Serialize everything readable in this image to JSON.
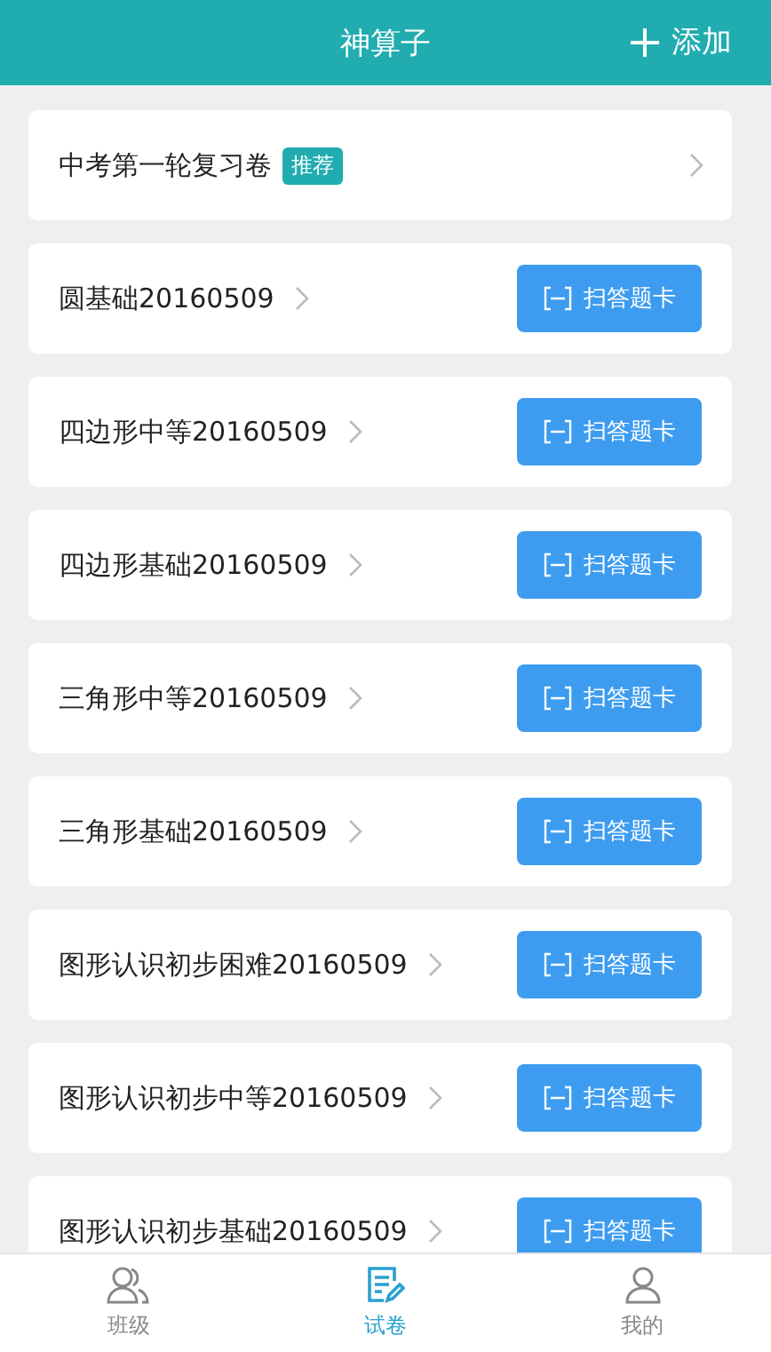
{
  "header": {
    "title": "神算子",
    "add_label": "添加"
  },
  "featured": {
    "title": "中考第一轮复习卷",
    "badge": "推荐"
  },
  "papers": [
    {
      "name": "圆基础20160509",
      "button": "扫答题卡"
    },
    {
      "name": "四边形中等20160509",
      "button": "扫答题卡"
    },
    {
      "name": "四边形基础20160509",
      "button": "扫答题卡"
    },
    {
      "name": "三角形中等20160509",
      "button": "扫答题卡"
    },
    {
      "name": "三角形基础20160509",
      "button": "扫答题卡"
    },
    {
      "name": "图形认识初步困难20160509",
      "button": "扫答题卡"
    },
    {
      "name": "图形认识初步中等20160509",
      "button": "扫答题卡"
    },
    {
      "name": "图形认识初步基础20160509",
      "button": "扫答题卡"
    }
  ],
  "tabs": [
    {
      "kind": "class",
      "label": "班级",
      "selected": false
    },
    {
      "kind": "paper",
      "label": "试卷",
      "selected": true
    },
    {
      "kind": "me",
      "label": "我的",
      "selected": false
    }
  ]
}
